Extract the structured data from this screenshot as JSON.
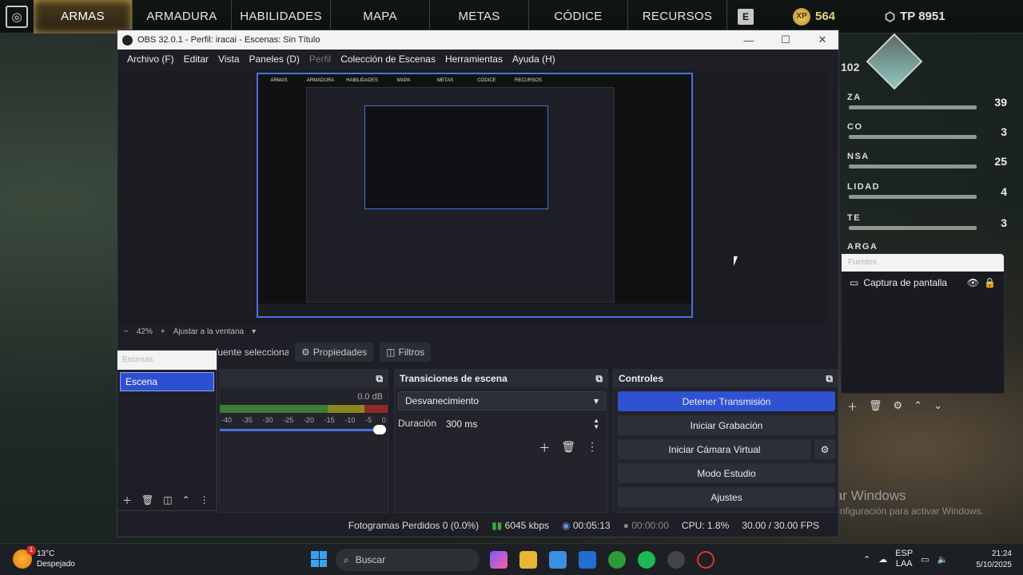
{
  "game": {
    "tabs": [
      "ARMAS",
      "ARMADURA",
      "HABILIDADES",
      "MAPA",
      "METAS",
      "CÓDICE",
      "RECURSOS"
    ],
    "key_label": "E",
    "xp_label": "XP",
    "xp_value": "564",
    "tp_value": "TP 8951",
    "level": "102",
    "stats": [
      {
        "label": "ZA",
        "value": "39"
      },
      {
        "label": "CO",
        "value": "3"
      },
      {
        "label": "NSA",
        "value": "25"
      },
      {
        "label": "LIDAD",
        "value": "4"
      },
      {
        "label": "TE",
        "value": "3"
      },
      {
        "label": "ARGA",
        "value": ""
      }
    ]
  },
  "obs": {
    "title": "OBS 32.0.1 - Perfil: iracai - Escenas: Sin Título",
    "menu": [
      "Archivo (F)",
      "Editar",
      "Vista",
      "Paneles (D)",
      "Perfil",
      "Colección de Escenas",
      "Herramientas",
      "Ayuda (H)"
    ],
    "zoom": "42%",
    "fit_label": "Ajustar a la ventana",
    "source_row_partial": "fuente seleccionada",
    "properties_label": "Propiedades",
    "filters_label": "Filtros",
    "scenes": {
      "header": "Escenas",
      "items": [
        "Escena"
      ]
    },
    "sources": {
      "header": "Fuentes",
      "items": [
        "Captura de pantalla"
      ]
    },
    "mixer": {
      "db": "0.0 dB",
      "ticks": [
        "-40",
        "-35",
        "-30",
        "-25",
        "-20",
        "-15",
        "-10",
        "-5",
        "0"
      ]
    },
    "transitions": {
      "header": "Transiciones de escena",
      "selected": "Desvanecimiento",
      "duration_label": "Duración",
      "duration_value": "300 ms"
    },
    "controls": {
      "header": "Controles",
      "buttons": [
        "Detener Transmisión",
        "Iniciar Grabación",
        "Iniciar Cámara Virtual",
        "Modo Estudio",
        "Ajustes"
      ]
    },
    "status": {
      "dropped": "Fotogramas Perdidos 0 (0.0%)",
      "kbps": "6045 kbps",
      "stream_time": "00:05:13",
      "rec_time": "00:00:00",
      "cpu": "CPU: 1.8%",
      "fps": "30.00 / 30.00 FPS"
    }
  },
  "watermark": {
    "line1": "Activar Windows",
    "line2": "Ve a Configuración para activar Windows."
  },
  "taskbar": {
    "temp": "13°C",
    "weather": "Despejado",
    "badge": "1",
    "search": "Buscar",
    "lang1": "ESP",
    "lang2": "LAA",
    "time": "21:24",
    "date": "5/10/2025"
  },
  "colors": {
    "accent": "#2f52d3",
    "gold": "#c8a14a"
  }
}
